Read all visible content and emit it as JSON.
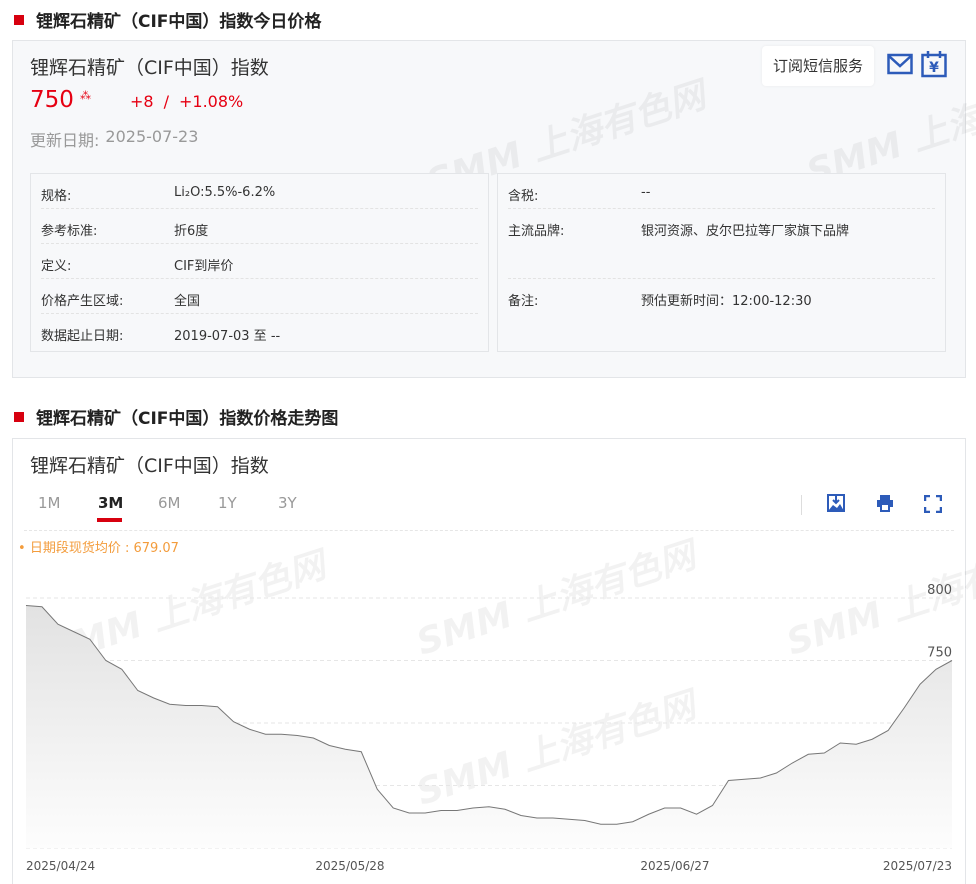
{
  "section1": {
    "title": "锂辉石精矿（CIF中国）指数今日价格"
  },
  "summary": {
    "name": "锂辉石精矿（CIF中国）指数",
    "price": "750",
    "change": "+8",
    "separator": "/",
    "change_pct": "+1.08%",
    "update_label": "更新日期:",
    "update_date": "2025-07-23",
    "sms_button": "订阅短信服务"
  },
  "specs_left": [
    {
      "k": "规格:",
      "v": "Li₂O:5.5%-6.2%"
    },
    {
      "k": "参考标准:",
      "v": "折6度"
    },
    {
      "k": "定义:",
      "v": "CIF到岸价"
    },
    {
      "k": "价格产生区域:",
      "v": "全国"
    },
    {
      "k": "数据起止日期:",
      "v": "2019-07-03 至 --"
    }
  ],
  "specs_right": [
    {
      "k": "含税:",
      "v": "--"
    },
    {
      "k": "主流品牌:",
      "v": "银河资源、皮尔巴拉等厂家旗下品牌"
    },
    {
      "k": "备注:",
      "v": "预估更新时间：12:00-12:30"
    }
  ],
  "section2": {
    "title": "锂辉石精矿（CIF中国）指数价格走势图"
  },
  "chart_panel": {
    "title": "锂辉石精矿（CIF中国）指数",
    "tabs": [
      "1M",
      "3M",
      "6M",
      "1Y",
      "3Y"
    ],
    "active_tab": "3M",
    "avg_label": "日期段现货均价 : 679.07"
  },
  "watermark": "SMM 上海有色网",
  "colors": {
    "accent": "#d7000f",
    "price_up": "#e60012",
    "icon": "#2d5bb9",
    "avg": "#f39c3c"
  },
  "chart_data": {
    "type": "area",
    "title": "锂辉石精矿（CIF中国）指数",
    "x_tick_labels": [
      "2025/04/24",
      "2025/05/28",
      "2025/06/27",
      "2025/07/23"
    ],
    "y_ticks": [
      600,
      650,
      700,
      750,
      800
    ],
    "ylim": [
      600,
      800
    ],
    "grid": true,
    "values": [
      794,
      793,
      779,
      773,
      767,
      750,
      743,
      726,
      720,
      715,
      714,
      714,
      713,
      701,
      695,
      691,
      691,
      690,
      688,
      682,
      679,
      677,
      647,
      632,
      628,
      628,
      630,
      630,
      632,
      633,
      631,
      626,
      624,
      624,
      623,
      622,
      619,
      619,
      621,
      627,
      632,
      632,
      627,
      634,
      654,
      655,
      656,
      660,
      668,
      675,
      676,
      684,
      683,
      687,
      694,
      712,
      731,
      743,
      750
    ]
  }
}
